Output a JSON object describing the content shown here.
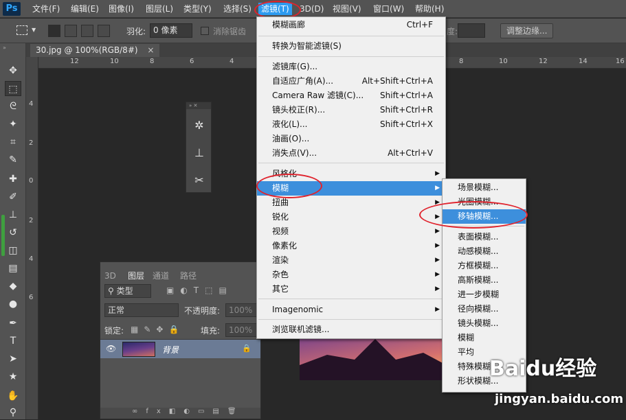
{
  "app": {
    "logo": "Ps"
  },
  "menubar": {
    "items": [
      "文件(F)",
      "编辑(E)",
      "图像(I)",
      "图层(L)",
      "类型(Y)",
      "选择(S)",
      "滤镜(T)",
      "3D(D)",
      "视图(V)",
      "窗口(W)",
      "帮助(H)"
    ]
  },
  "options": {
    "feather_label": "羽化:",
    "feather_value": "0 像素",
    "antialias_label": "消除锯齿",
    "partial_label": "度:",
    "refine_edge": "调整边缘..."
  },
  "document": {
    "tab": "30.jpg @ 100%(RGB/8#)",
    "tab_close": "×"
  },
  "rulers": {
    "h": [
      "12",
      "10",
      "8",
      "6",
      "4",
      "2",
      "0",
      "2",
      "4",
      "6",
      "8",
      "10",
      "12",
      "14",
      "16"
    ],
    "v": [
      "4",
      "2",
      "0",
      "2",
      "4",
      "6"
    ]
  },
  "filter_menu": {
    "last_filter": {
      "label": "模糊画廊",
      "shortcut": "Ctrl+F"
    },
    "smart": "转换为智能滤镜(S)",
    "group2": [
      {
        "label": "滤镜库(G)...",
        "shortcut": ""
      },
      {
        "label": "自适应广角(A)...",
        "shortcut": "Alt+Shift+Ctrl+A"
      },
      {
        "label": "Camera Raw 滤镜(C)...",
        "shortcut": "Shift+Ctrl+A"
      },
      {
        "label": "镜头校正(R)...",
        "shortcut": "Shift+Ctrl+R"
      },
      {
        "label": "液化(L)...",
        "shortcut": "Shift+Ctrl+X"
      },
      {
        "label": "油画(O)...",
        "shortcut": ""
      },
      {
        "label": "消失点(V)...",
        "shortcut": "Alt+Ctrl+V"
      }
    ],
    "submenus": [
      "风格化",
      "模糊",
      "扭曲",
      "锐化",
      "视频",
      "像素化",
      "渲染",
      "杂色",
      "其它"
    ],
    "imagenomic": "Imagenomic",
    "browse": "浏览联机滤镜..."
  },
  "blur_menu": {
    "items": [
      "场景模糊...",
      "光圈模糊...",
      "移轴模糊...",
      "表面模糊...",
      "动感模糊...",
      "方框模糊...",
      "高斯模糊...",
      "进一步模糊",
      "径向模糊...",
      "镜头模糊...",
      "模糊",
      "平均",
      "特殊模糊...",
      "形状模糊..."
    ]
  },
  "layers_panel": {
    "tabs": [
      "3D",
      "图层",
      "通道",
      "路径"
    ],
    "filter_kind": "类型",
    "blend_mode": "正常",
    "opacity_label": "不透明度:",
    "opacity_value": "100%",
    "lock_label": "锁定:",
    "fill_label": "填充:",
    "fill_value": "100%",
    "layer_name": "背景"
  },
  "watermark": {
    "brand": "Baidu经验",
    "url": "jingyan.baidu.com"
  },
  "colors": {
    "highlight": "#3d8fdc",
    "annotation": "#e0232d"
  }
}
